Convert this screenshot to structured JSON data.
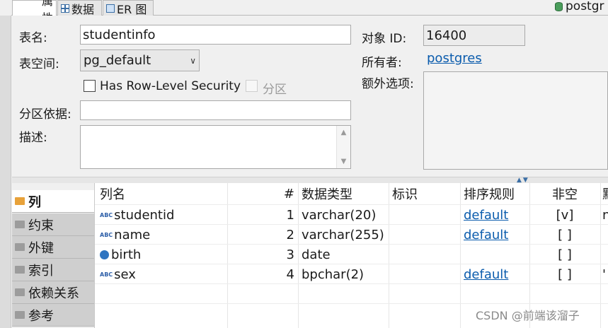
{
  "tabs": [
    {
      "label": "属性",
      "icon": "table-grid-icon"
    },
    {
      "label": "数据",
      "icon": "data-icon"
    },
    {
      "label": "ER 图",
      "icon": "er-diagram-icon"
    }
  ],
  "connection_label": "postgr",
  "properties": {
    "table_name_label": "表名:",
    "table_name_value": "studentinfo",
    "tablespace_label": "表空间:",
    "tablespace_value": "pg_default",
    "rls_label": "Has Row-Level Security",
    "partition_label": "分区",
    "partition_by_label": "分区依据:",
    "partition_by_value": "",
    "description_label": "描述:",
    "description_value": "",
    "object_id_label": "对象 ID:",
    "object_id_value": "16400",
    "owner_label": "所有者:",
    "owner_value": "postgres",
    "extra_options_label": "额外选项:"
  },
  "side_tabs": [
    {
      "label": "列",
      "active": true
    },
    {
      "label": "约束",
      "active": false
    },
    {
      "label": "外键",
      "active": false
    },
    {
      "label": "索引",
      "active": false
    },
    {
      "label": "依赖关系",
      "active": false
    },
    {
      "label": "参考",
      "active": false
    }
  ],
  "columns_table": {
    "headers": [
      "列名",
      "#",
      "数据类型",
      "标识",
      "排序规则",
      "非空",
      "默"
    ],
    "rows": [
      {
        "name": "studentid",
        "num": "1",
        "type": "varchar(20)",
        "identity": "",
        "collation": "default",
        "not_null": "[v]",
        "default": "n"
      },
      {
        "name": "name",
        "num": "2",
        "type": "varchar(255)",
        "identity": "",
        "collation": "default",
        "not_null": "[ ]",
        "default": ""
      },
      {
        "name": "birth",
        "num": "3",
        "type": "date",
        "identity": "",
        "collation": "",
        "not_null": "[ ]",
        "default": ""
      },
      {
        "name": "sex",
        "num": "4",
        "type": "bpchar(2)",
        "identity": "",
        "collation": "default",
        "not_null": "[ ]",
        "default": "'"
      }
    ]
  },
  "watermark": "CSDN @前端该溜子",
  "colors": {
    "link": "#0b5cad",
    "accent": "#3a6ea5"
  }
}
